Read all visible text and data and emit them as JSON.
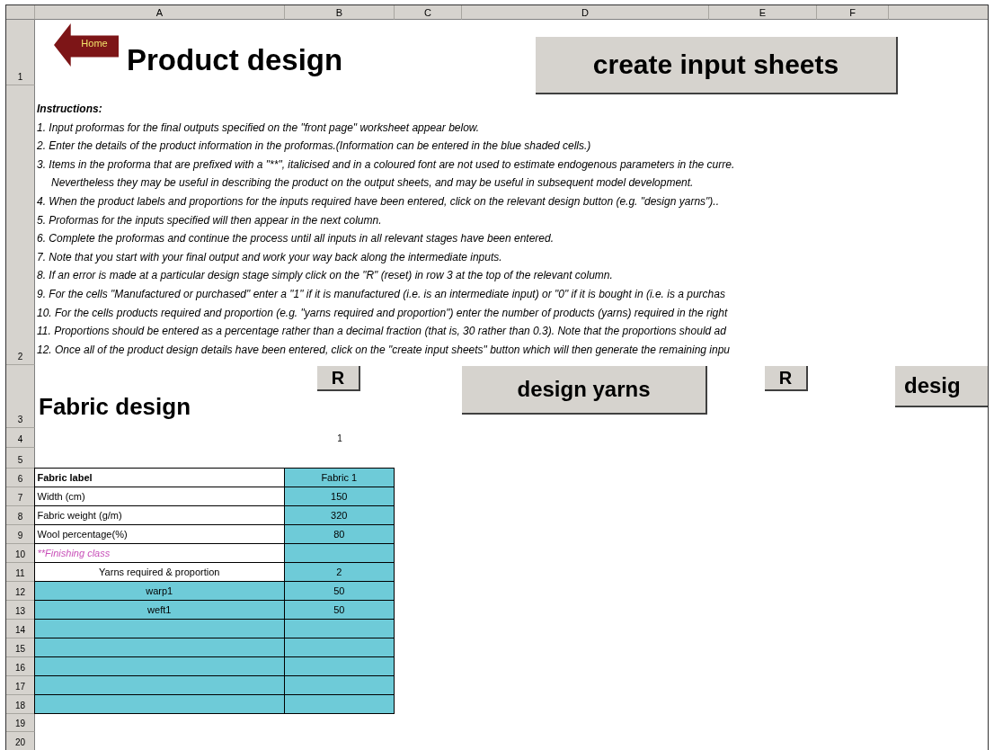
{
  "column_headers": [
    "A",
    "B",
    "C",
    "D",
    "E",
    "F"
  ],
  "row_headers": [
    "1",
    "2",
    "3",
    "4",
    "5",
    "6",
    "7",
    "8",
    "9",
    "10",
    "11",
    "12",
    "13",
    "14",
    "15",
    "16",
    "17",
    "18",
    "19",
    "20"
  ],
  "home_button": "Home",
  "title": "Product design",
  "create_button": "create input sheets",
  "instructions": {
    "heading": "Instructions:",
    "lines": [
      {
        "kind": "item",
        "text": "1. Input proformas for the final outputs specified on the \"front page\" worksheet appear below."
      },
      {
        "kind": "item",
        "text": "2. Enter the details of the product information in the proformas.(Information can be entered in the blue shaded cells.)"
      },
      {
        "kind": "item",
        "text": "3. Items in the proforma that are prefixed with a \"**\", italicised and in a coloured font are not used to estimate endogenous parameters in the curre."
      },
      {
        "kind": "continuation",
        "text": "Nevertheless they may be useful in describing the product on the output sheets, and may be useful in subsequent model development."
      },
      {
        "kind": "item",
        "text": "4. When the product labels and proportions for the inputs required have been entered, click on the relevant design button (e.g. \"design yarns\").."
      },
      {
        "kind": "item",
        "text": "5. Proformas for the inputs specified will then appear in the next column."
      },
      {
        "kind": "item",
        "text": "6. Complete the proformas and continue the process until all inputs in all relevant stages have been entered."
      },
      {
        "kind": "item",
        "text": "7. Note that you start with your final output and work your way back along the intermediate inputs."
      },
      {
        "kind": "item",
        "text": "8. If an error is made at a particular design stage simply click on the \"R\" (reset) in row 3 at the top of the relevant column."
      },
      {
        "kind": "item",
        "text": "9. For the cells \"Manufactured or purchased\" enter a \"1\" if it is manufactured (i.e. is an intermediate input) or \"0\" if it is bought in (i.e. is a purchas"
      },
      {
        "kind": "item",
        "text": "10. For the cells products required and proportion (e.g. \"yarns required and proportion\") enter the number of products (yarns) required in the right"
      },
      {
        "kind": "item",
        "text": "11. Proportions should be entered as a percentage rather than a decimal fraction (that is, 30 rather than 0.3). Note that the proportions should ad"
      },
      {
        "kind": "item",
        "text": "12. Once all of the product design details have been entered, click on the \"create input sheets\" button which will then generate the remaining inpu"
      }
    ]
  },
  "section_title": "Fabric design",
  "reset_buttons": [
    "R",
    "R"
  ],
  "counter": "1",
  "design_buttons": [
    "design yarns",
    "desig"
  ],
  "table": {
    "rows": [
      {
        "kind": "header",
        "label": "Fabric label",
        "value": "Fabric 1"
      },
      {
        "kind": "field",
        "label": "Width (cm)",
        "value": "150"
      },
      {
        "kind": "field",
        "label": "Fabric weight (g/m)",
        "value": "320"
      },
      {
        "kind": "field",
        "label": "Wool percentage(%)",
        "value": "80"
      },
      {
        "kind": "optional",
        "label": "**Finishing class"
      },
      {
        "kind": "section",
        "label": "Yarns required & proportion",
        "value": "2"
      },
      {
        "kind": "input",
        "label": "warp1",
        "value": "50"
      },
      {
        "kind": "input",
        "label": "weft1",
        "value": "50"
      },
      {
        "kind": "input"
      },
      {
        "kind": "input"
      },
      {
        "kind": "input"
      },
      {
        "kind": "input"
      },
      {
        "kind": "input"
      }
    ]
  }
}
